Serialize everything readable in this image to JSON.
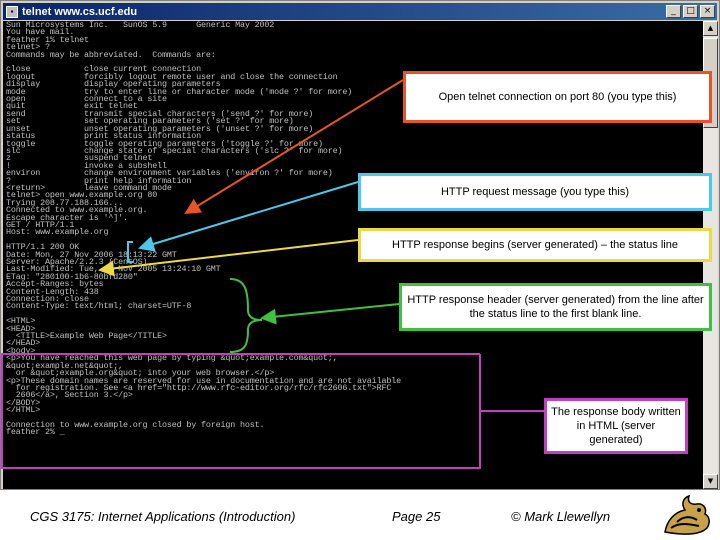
{
  "window": {
    "title": "telnet www.cs.ucf.edu",
    "minimize": "_",
    "maximize": "□",
    "close": "×"
  },
  "console_text": "Sun Microsystems Inc.   SunOS 5.9      Generic May 2002\nYou have mail.\nfeather 1% telnet\ntelnet> ?\nCommands may be abbreviated.  Commands are:\n\nclose           close current connection\nlogout          forcibly logout remote user and close the connection\ndisplay         display operating parameters\nmode            try to enter line or character mode ('mode ?' for more)\nopen            connect to a site\nquit            exit telnet\nsend            transmit special characters ('send ?' for more)\nset             set operating parameters ('set ?' for more)\nunset           unset operating parameters ('unset ?' for more)\nstatus          print status information\ntoggle          toggle operating parameters ('toggle ?' for more)\nslc             change state of special characters ('slc ?' for more)\nz               suspend telnet\n!               invoke a subshell\nenviron         change environment variables ('environ ?' for more)\n?               print help information\n<return>        leave command mode\ntelnet> open www.example.org 80\nTrying 208.77.188.166...\nConnected to www.example.org.\nEscape character is '^]'.\nGET / HTTP/1.1\nHost: www.example.org\n\nHTTP/1.1 200 OK\nDate: Mon, 27 Nov 2006 18:13:22 GMT\nServer: Apache/2.2.3 (CentOS)\nLast-Modified: Tue, 15 Nov 2005 13:24:10 GMT\nETag: \"280100-1b6-80bfd280\"\nAccept-Ranges: bytes\nContent-Length: 438\nConnection: close\nContent-Type: text/html; charset=UTF-8\n\n<HTML>\n<HEAD>\n  <TITLE>Example Web Page</TITLE>\n</HEAD>\n<body>\n<p>You have reached this web page by typing &quot;example.com&quot;,\n&quot;example.net&quot;,\n  or &quot;example.org&quot; into your web browser.</p>\n<p>These domain names are reserved for use in documentation and are not available\n  for registration. See <a href=\"http://www.rfc-editor.org/rfc/rfc2606.txt\">RFC\n  2606</a>, Section 3.</p>\n</BODY>\n</HTML>\n\nConnection to www.example.org closed by foreign host.\nfeather 2% _",
  "callouts": {
    "open_connection": "Open telnet connection on port 80 (you type this)",
    "request": "HTTP request message (you type this)",
    "status_line": "HTTP response begins (server generated) – the status line",
    "header": "HTTP response header (server generated) from the line after the status line to the first blank line.",
    "body": "The response body written in HTML (server generated)"
  },
  "footer": {
    "course": "CGS 3175: Internet Applications (Introduction)",
    "page": "Page 25",
    "author": "© Mark Llewellyn"
  },
  "colors": {
    "orange": "#e8542a",
    "cyan": "#4ec8e8",
    "yellow": "#ecd94a",
    "green": "#40c040",
    "magenta": "#c040c0"
  }
}
